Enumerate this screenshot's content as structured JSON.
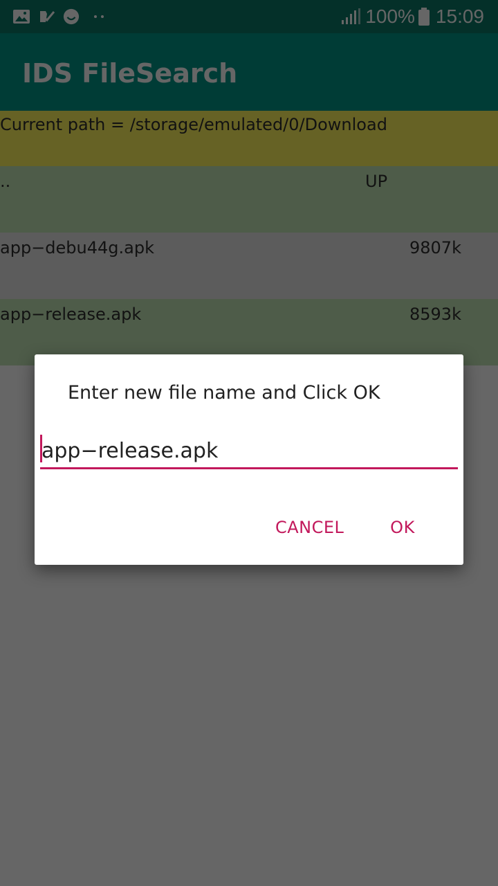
{
  "status_bar": {
    "icons": [
      "image-icon",
      "task-check-icon",
      "smiley-icon",
      "more-dots-icon"
    ],
    "battery_percent": "100%",
    "time": "15:09",
    "color": "#0b7867"
  },
  "app_bar": {
    "title": "IDS FileSearch",
    "color": "#009688"
  },
  "content": {
    "current_path": "Current path = /storage/emulated/0/Download",
    "rows": [
      {
        "name": "..",
        "info": "UP"
      },
      {
        "name": "app−debu44g.apk",
        "info": "9807k"
      },
      {
        "name": "app−release.apk",
        "info": "8593k"
      }
    ]
  },
  "dialog": {
    "title": "Enter new file name and Click OK",
    "input_value": "app−release.apk",
    "cancel_label": "CANCEL",
    "ok_label": "OK",
    "accent_color": "#c2185b"
  }
}
